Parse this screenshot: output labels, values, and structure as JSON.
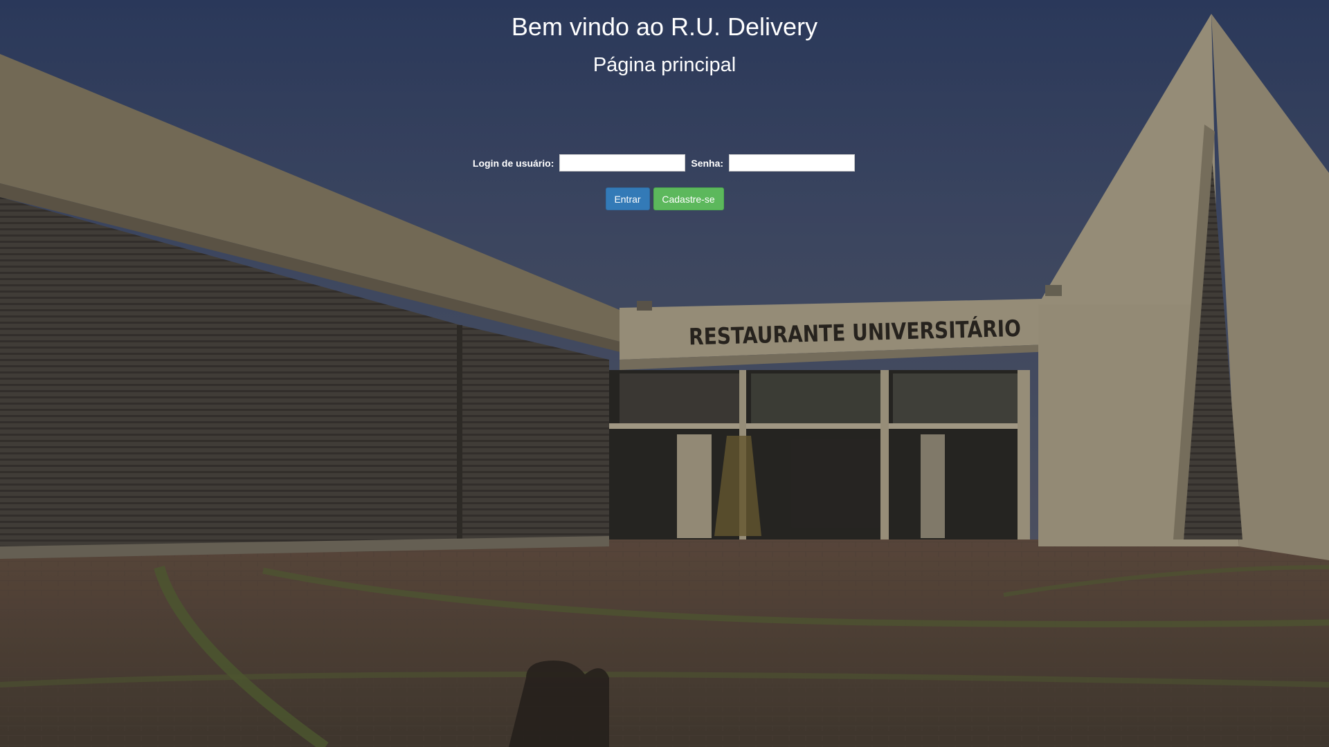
{
  "header": {
    "title": "Bem vindo ao R.U. Delivery",
    "subtitle": "Página principal"
  },
  "login_form": {
    "username_label": "Login de usuário:",
    "username_value": "",
    "password_label": "Senha:",
    "password_value": ""
  },
  "buttons": {
    "login_label": "Entrar",
    "signup_label": "Cadastre-se"
  },
  "background": {
    "sign_text": "RESTAURANTE UNIVERSITÁRIO"
  },
  "colors": {
    "primary": "#337ab7",
    "success": "#5cb85c",
    "text": "#ffffff"
  }
}
